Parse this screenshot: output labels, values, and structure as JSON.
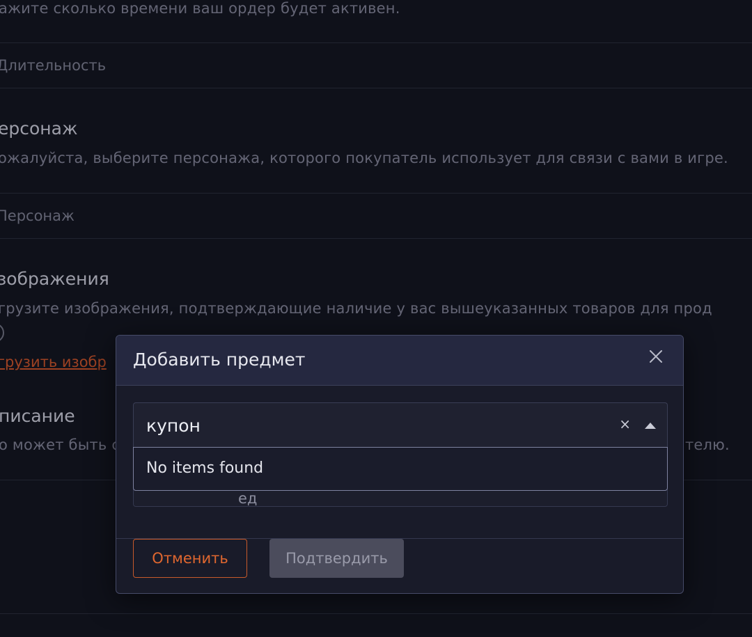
{
  "background_form": {
    "duration_hint": "ажите сколько времени ваш ордер будет активен.",
    "duration_placeholder": "Длительность",
    "character_heading": "ерсонаж",
    "character_hint": "ожалуйста, выберите персонажа, которого покупатель использует для связи с вами в игре.",
    "character_placeholder": "Персонаж",
    "images_heading": "зображения",
    "images_hint": "грузите изображения, подтверждающие наличие у вас вышеуказанных товаров для прод",
    "upload_link": "грузить изобр",
    "description_heading": "писание",
    "description_hint_start": "о может быть с",
    "description_hint_end": "телю."
  },
  "modal": {
    "title": "Добавить предмет",
    "close_icon": "close-icon",
    "select": {
      "value": "купон",
      "clear_symbol": "×",
      "caret_icon": "caret-up-icon"
    },
    "dropdown_message": "No items found",
    "obscured_field_text": "ед",
    "cancel_label": "Отменить",
    "confirm_label": "Подтвердить"
  },
  "colors": {
    "page_bg": "#13151f",
    "modal_bg": "#191b29",
    "modal_header_bg": "#252840",
    "accent_orange": "#e0672f",
    "disabled_button_bg": "#4b4c5c"
  }
}
